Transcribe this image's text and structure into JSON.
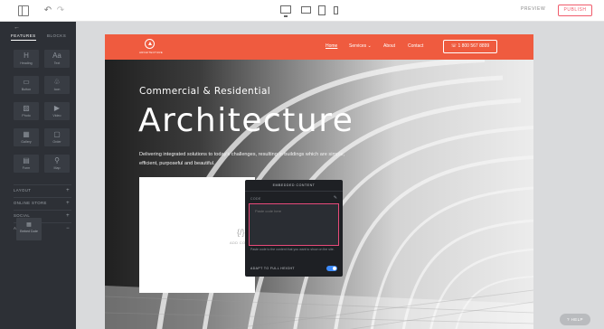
{
  "toolbar": {
    "preview_label": "PREVIEW",
    "publish_label": "PUBLISH",
    "undo_glyph": "↶",
    "redo_glyph": "↷"
  },
  "sidebar": {
    "back_glyph": "←",
    "tabs": [
      {
        "label": "FEATURES",
        "active": true
      },
      {
        "label": "BLOCKS",
        "active": false
      }
    ],
    "tiles": [
      {
        "label": "Heading",
        "glyph": "H",
        "icon": "heading-icon"
      },
      {
        "label": "Text",
        "glyph": "Aa",
        "icon": "text-icon"
      },
      {
        "label": "Button",
        "glyph": "▭",
        "icon": "button-icon"
      },
      {
        "label": "Icon",
        "glyph": "♧",
        "icon": "icon-icon"
      },
      {
        "label": "Photo",
        "glyph": "▨",
        "icon": "photo-icon"
      },
      {
        "label": "Video",
        "glyph": "▶",
        "icon": "video-icon"
      },
      {
        "label": "Gallery",
        "glyph": "▦",
        "icon": "gallery-icon"
      },
      {
        "label": "Order",
        "glyph": "▢",
        "icon": "order-icon"
      },
      {
        "label": "Form",
        "glyph": "▤",
        "icon": "form-icon"
      },
      {
        "label": "Map",
        "glyph": "⚲",
        "icon": "map-icon"
      }
    ],
    "sections": [
      {
        "label": "LAYOUT",
        "plus": "+"
      },
      {
        "label": "ONLINE STORE",
        "plus": "+"
      },
      {
        "label": "SOCIAL",
        "plus": "+"
      },
      {
        "label": "ADVANCED",
        "plus": "−"
      }
    ],
    "embed_tile": {
      "label": "Embed Code",
      "glyph": "▦",
      "icon": "embed-code-icon"
    }
  },
  "site": {
    "logo_text": "ARCHITECTURE",
    "nav": {
      "home": "Home",
      "services": "Services ⌄",
      "about": "About",
      "contact": "Contact",
      "phone": "☏ 1 800 567 8899"
    },
    "hero": {
      "subtitle": "Commercial & Residential",
      "title": "Architecture",
      "description": "Delivering integrated solutions to today's challenges, resulting in buildings which are simple, efficient, purposeful and beautiful."
    },
    "embed_placeholder": {
      "glyph": "{/}",
      "text": "ADD CODE"
    }
  },
  "embed_panel": {
    "title": "EMBEDDED CONTENT",
    "code_label": "CODE",
    "code_placeholder": "Paste code here",
    "help_text": "Paste code to the content that you want to show on the site.",
    "adapt_label": "ADAPT TO FULL HEIGHT",
    "adapt_enabled": true
  },
  "help_button": {
    "label": "? HELP"
  },
  "colors": {
    "accent": "#ef5b3f",
    "publish": "#f05b6b",
    "highlight": "#e84a7a",
    "toggle": "#3d8bfd",
    "sidebar_bg": "#2d3036"
  }
}
